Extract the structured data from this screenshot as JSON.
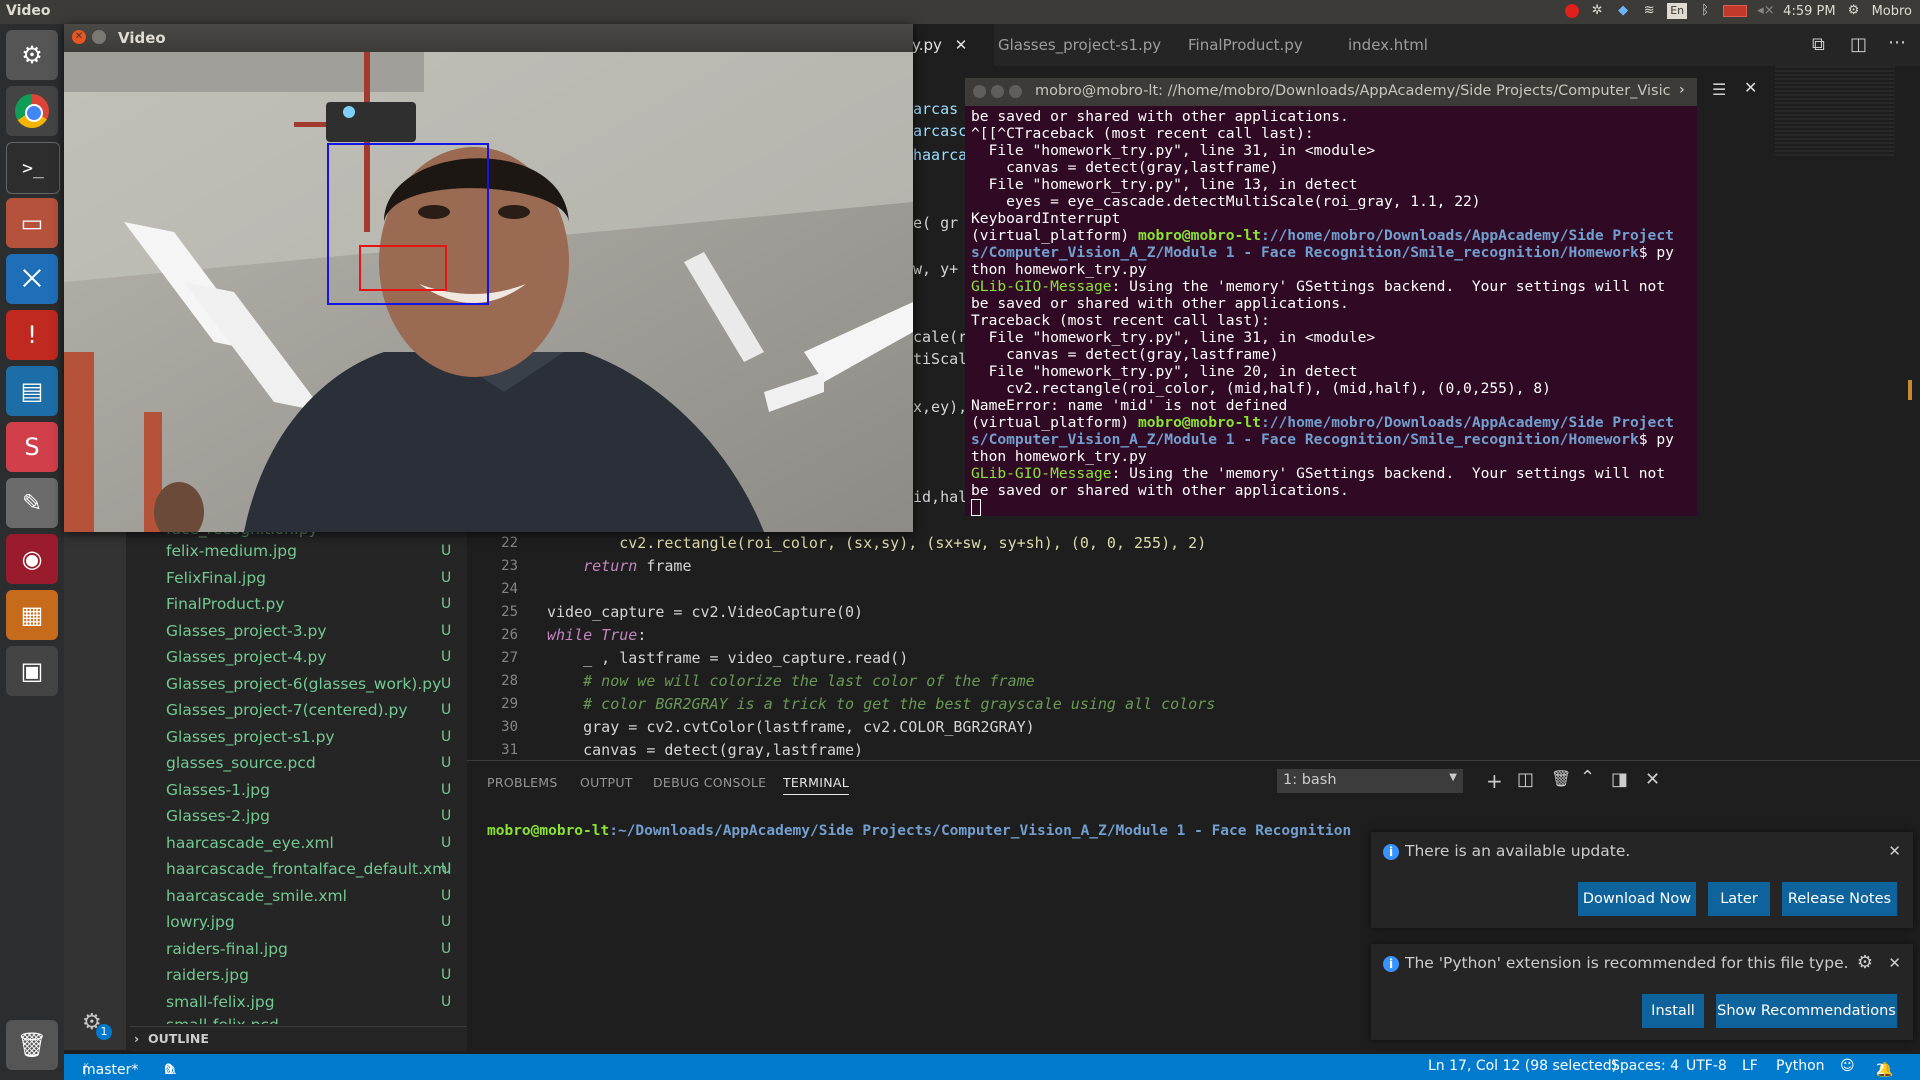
{
  "topbar": {
    "title": "Video",
    "time": "4:59 PM",
    "user": "Mobro",
    "lang": "En"
  },
  "launcher": {
    "icons": [
      "settings-icon",
      "chrome-icon",
      "terminal-icon",
      "files-icon",
      "vscode-icon",
      "update-icon",
      "writer-icon",
      "slack-icon",
      "text-editor-icon",
      "app-icon",
      "video-icon",
      "workspace-icon",
      "trash-icon"
    ]
  },
  "tabs": [
    {
      "label": "y.py"
    },
    {
      "label": "Glasses_project-s1.py"
    },
    {
      "label": "FinalProduct.py"
    },
    {
      "label": "index.html"
    }
  ],
  "code": {
    "fragments": [
      "arcas",
      "arcasc",
      "haarca",
      "e( gr",
      "w, y+",
      "cale(r",
      "tiScal",
      "x,ey),",
      "id,hal"
    ],
    "lines": [
      {
        "num": "22",
        "text": "        cv2.rectangle(roi_color, (sx,sy), (sx+sw, sy+sh), (0, 0, 255), 2)"
      },
      {
        "num": "23",
        "text": "    return frame"
      },
      {
        "num": "24",
        "text": ""
      },
      {
        "num": "25",
        "text": "video_capture = cv2.VideoCapture(0)"
      },
      {
        "num": "26",
        "text": "while True:"
      },
      {
        "num": "27",
        "text": "    _ , lastframe = video_capture.read()"
      },
      {
        "num": "28",
        "text": "    # now we will colorize the last color of the frame"
      },
      {
        "num": "29",
        "text": "    # color BGR2GRAY is a trick to get the best grayscale using all colors"
      },
      {
        "num": "30",
        "text": "    gray = cv2.cvtColor(lastframe, cv2.COLOR_BGR2GRAY)"
      },
      {
        "num": "31",
        "text": "    canvas = detect(gray,lastframe)"
      }
    ]
  },
  "explorer": {
    "partial_top": "face_recognition.py",
    "files": [
      {
        "name": "felix-medium.jpg",
        "status": "U"
      },
      {
        "name": "FelixFinal.jpg",
        "status": "U"
      },
      {
        "name": "FinalProduct.py",
        "status": "U"
      },
      {
        "name": "Glasses_project-3.py",
        "status": "U"
      },
      {
        "name": "Glasses_project-4.py",
        "status": "U"
      },
      {
        "name": "Glasses_project-6(glasses_work).py",
        "status": "U"
      },
      {
        "name": "Glasses_project-7(centered).py",
        "status": "U"
      },
      {
        "name": "Glasses_project-s1.py",
        "status": "U"
      },
      {
        "name": "glasses_source.pcd",
        "status": "U"
      },
      {
        "name": "Glasses-1.jpg",
        "status": "U"
      },
      {
        "name": "Glasses-2.jpg",
        "status": "U"
      },
      {
        "name": "haarcascade_eye.xml",
        "status": "U"
      },
      {
        "name": "haarcascade_frontalface_default.xml",
        "status": "U"
      },
      {
        "name": "haarcascade_smile.xml",
        "status": "U"
      },
      {
        "name": "lowry.jpg",
        "status": "U"
      },
      {
        "name": "raiders-final.jpg",
        "status": "U"
      },
      {
        "name": "raiders.jpg",
        "status": "U"
      },
      {
        "name": "small-felix.jpg",
        "status": "U"
      }
    ],
    "partial_bottom": "small-felix.pcd",
    "outline_label": "OUTLINE",
    "badge": "1"
  },
  "panel": {
    "tabs": [
      "PROBLEMS",
      "OUTPUT",
      "DEBUG CONSOLE",
      "TERMINAL"
    ],
    "active_tab": "TERMINAL",
    "shell_select": "1: bash",
    "prompt_user": "mobro@mobro-lt",
    "prompt_path": ":~/Downloads/AppAcademy/Side Projects/Computer_Vision_A_Z/Module 1 - Face Recognition"
  },
  "notifications": {
    "update": {
      "message": "There is an available update.",
      "buttons": [
        "Download Now",
        "Later",
        "Release Notes"
      ]
    },
    "python": {
      "message": "The 'Python' extension is recommended for this file type.",
      "buttons": [
        "Install",
        "Show Recommendations"
      ]
    }
  },
  "statusbar": {
    "branch": "master*",
    "errors": "0",
    "warnings": "0",
    "position": "Ln 17, Col 12 (98 selected)",
    "spaces": "Spaces: 4",
    "encoding": "UTF-8",
    "eol": "LF",
    "language": "Python",
    "bell_count": "2"
  },
  "video": {
    "title": "Video"
  },
  "terminal": {
    "title": "mobro@mobro-lt: //home/mobro/Downloads/AppAcademy/Side Projects/Computer_Visic",
    "lines": [
      "be saved or shared with other applications.",
      "^[[^CTraceback (most recent call last):",
      "  File \"homework_try.py\", line 31, in <module>",
      "    canvas = detect(gray,lastframe)",
      "  File \"homework_try.py\", line 13, in detect",
      "    eyes = eye_cascade.detectMultiScale(roi_gray, 1.1, 22)",
      "KeyboardInterrupt",
      "(virtual_platform) mobro@mobro-lt://home/mobro/Downloads/AppAcademy/Side Project",
      "s/Computer_Vision_A_Z/Module 1 - Face Recognition/Smile_recognition/Homework$ py",
      "thon homework_try.py",
      "GLib-GIO-Message: Using the 'memory' GSettings backend.  Your settings will not",
      "be saved or shared with other applications.",
      "Traceback (most recent call last):",
      "  File \"homework_try.py\", line 31, in <module>",
      "    canvas = detect(gray,lastframe)",
      "  File \"homework_try.py\", line 20, in detect",
      "    cv2.rectangle(roi_color, (mid,half), (mid,half), (0,0,255), 8)",
      "NameError: name 'mid' is not defined",
      "(virtual_platform) mobro@mobro-lt://home/mobro/Downloads/AppAcademy/Side Project",
      "s/Computer_Vision_A_Z/Module 1 - Face Recognition/Smile_recognition/Homework$ py",
      "thon homework_try.py",
      "GLib-GIO-Message: Using the 'memory' GSettings backend.  Your settings will not",
      "be saved or shared with other applications."
    ]
  },
  "colors": {
    "accent": "#007acc",
    "terminal_bg": "#300a24",
    "prompt_green": "#8ae234",
    "prompt_blue": "#729fcf",
    "file_untracked": "#73c991"
  }
}
